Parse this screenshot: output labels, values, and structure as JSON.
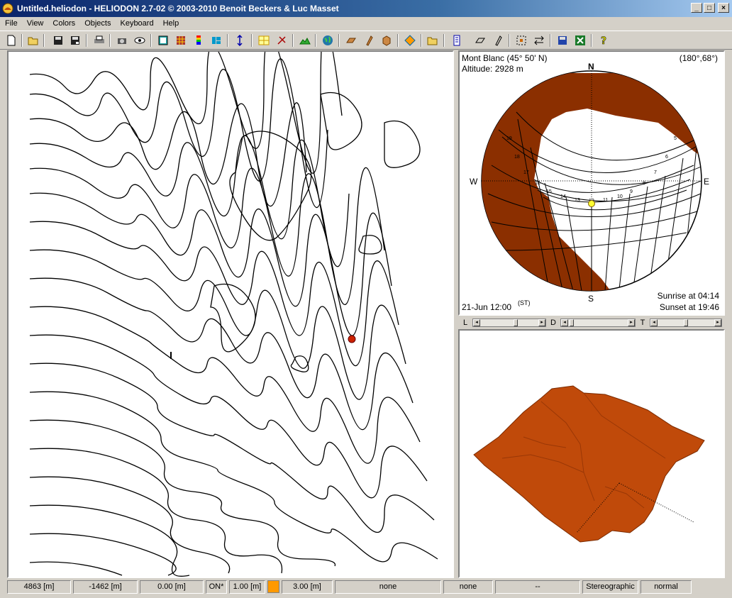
{
  "window": {
    "title": "Untitled.heliodon  -  HELIODON 2.7-02 © 2003-2010 Benoit Beckers & Luc Masset",
    "minimize": "_",
    "maximize": "□",
    "close": "×"
  },
  "menu": [
    "File",
    "View",
    "Colors",
    "Objects",
    "Keyboard",
    "Help"
  ],
  "toolbar_icons": [
    "new-icon",
    "open-icon",
    "save-icon",
    "save-as-icon",
    "print-icon",
    "camera-icon",
    "eye-icon",
    "frame-icon",
    "grid-color-icon",
    "palette-icon",
    "tile-icon",
    "swap-vertical-icon",
    "layout-icon",
    "compass-icon",
    "terrain-icon",
    "globe-icon",
    "plane-icon",
    "pencil-icon",
    "box-icon",
    "diamond-icon",
    "folder-open-icon",
    "document-icon",
    "plane-outline-icon",
    "pen-icon",
    "select-icon",
    "exchange-icon",
    "save-data-icon",
    "excel-icon",
    "help-icon"
  ],
  "sky": {
    "location": "Mont Blanc (45° 50' N)",
    "altitude": "Altitude: 2928 m",
    "view_angle": "(180°,68°)",
    "north": "N",
    "south": "S",
    "west": "W",
    "east": "E",
    "date_time": "21-Jun 12:00",
    "time_suffix": "(ST)",
    "sunrise": "Sunrise at 04:14",
    "sunset": "Sunset at 19:46",
    "hour_labels": [
      "5",
      "6",
      "7",
      "8",
      "9",
      "10",
      "11",
      "12",
      "13",
      "14",
      "15",
      "16",
      "17",
      "18",
      "19"
    ]
  },
  "sliders": [
    {
      "label": "L",
      "value": 0.62
    },
    {
      "label": "D",
      "value": 0.02
    },
    {
      "label": "T",
      "value": 0.5
    }
  ],
  "status": {
    "x": "4863 [m]",
    "y": "-1462 [m]",
    "z": "0.00 [m]",
    "mode": "ON*",
    "scale": "1.00 [m]",
    "swatch_color": "#ff9900",
    "step": "3.00 [m]",
    "field1": "none",
    "field2": "none",
    "field3": "--",
    "projection": "Stereographic",
    "render": "normal"
  },
  "colors": {
    "terrain": "#c04a0a",
    "shadow_mask": "#8b2f00",
    "marker": "#cc2200",
    "sun": "#ffff33"
  }
}
